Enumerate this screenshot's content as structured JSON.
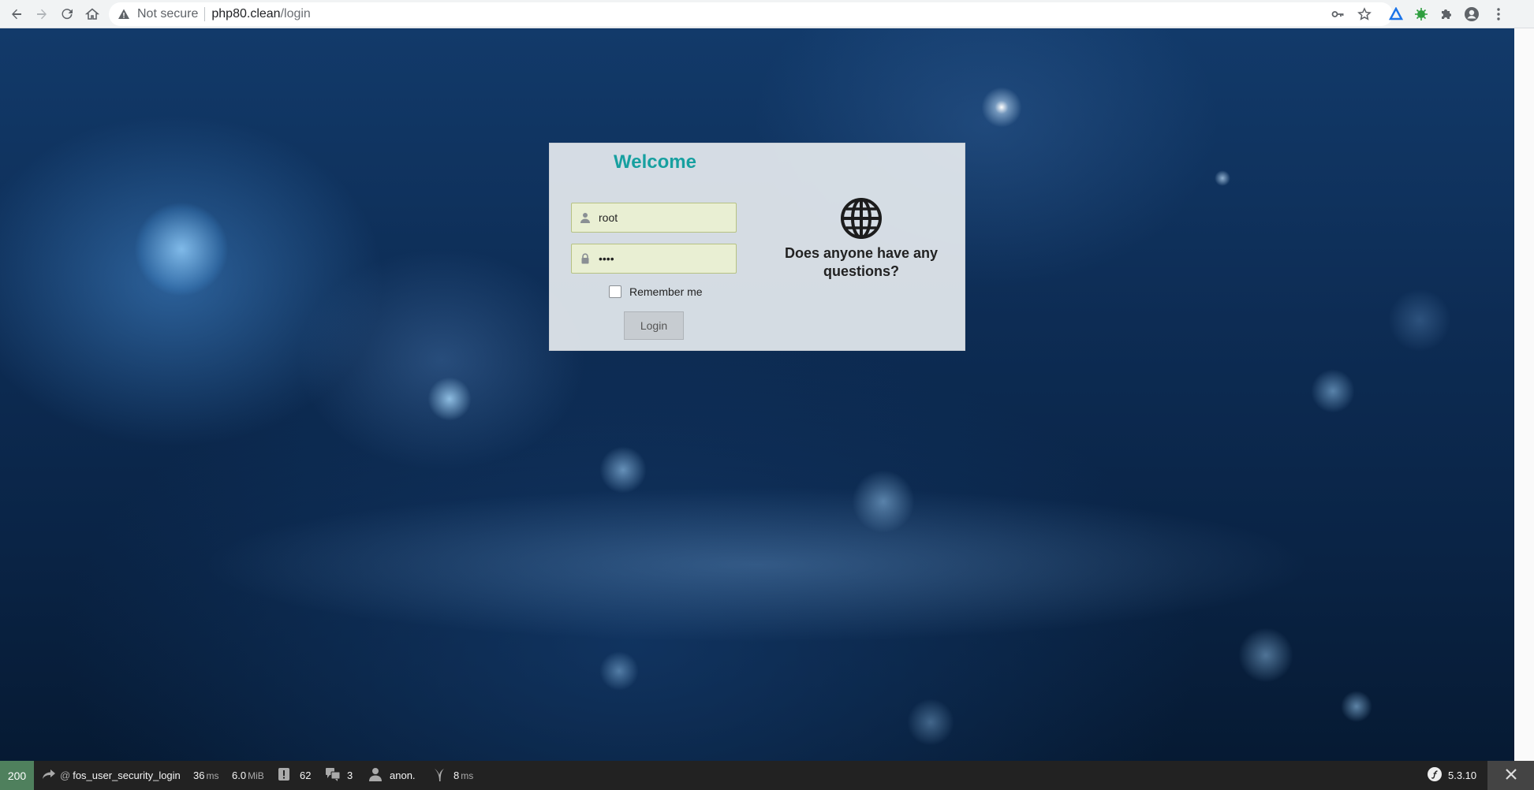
{
  "browser": {
    "security_label": "Not secure",
    "url_host": "php80.clean",
    "url_path": "/login",
    "icons": [
      "back-arrow-icon",
      "forward-arrow-icon",
      "reload-icon",
      "home-icon",
      "warning-icon",
      "key-icon",
      "star-icon",
      "extension-icon",
      "profile-icon",
      "menu-icon"
    ]
  },
  "login": {
    "title": "Welcome",
    "username_value": "root",
    "password_value": "••••",
    "remember_label": "Remember me",
    "login_button": "Login",
    "question": "Does anyone have any questions?"
  },
  "toolbar": {
    "status_code": "200",
    "route": "fos_user_security_login",
    "route_prefix": "@",
    "time_value": "36",
    "time_unit": "ms",
    "memory_value": "6.0",
    "memory_unit": "MiB",
    "logs_count": "62",
    "translations_count": "3",
    "user": "anon.",
    "twig_time": "8",
    "twig_unit": "ms",
    "symfony_version": "5.3.10"
  },
  "colors": {
    "title": "#17a0a0",
    "status_ok": "#4f805d",
    "toolbar_bg": "#222222"
  }
}
